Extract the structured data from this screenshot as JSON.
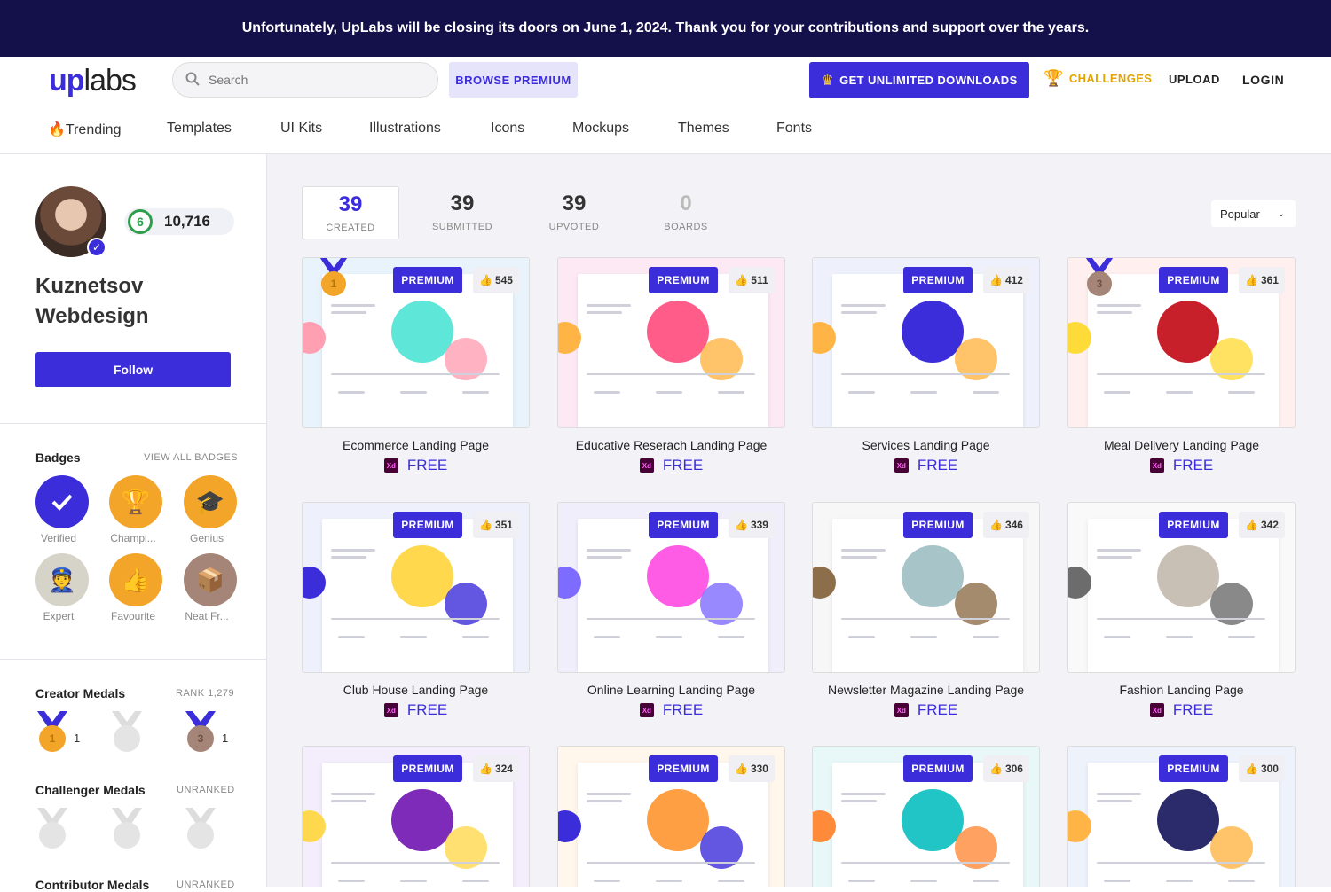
{
  "banner": "Unfortunately, UpLabs will be closing its doors on June 1, 2024. Thank you for your contributions and support over the years.",
  "header": {
    "logo_up": "up",
    "logo_labs": "labs",
    "search_placeholder": "Search",
    "browse_premium": "BROWSE PREMIUM",
    "unlimited": "GET UNLIMITED DOWNLOADS",
    "challenges": "CHALLENGES",
    "upload": "UPLOAD",
    "login": "LOGIN"
  },
  "nav": [
    "🔥Trending",
    "Templates",
    "UI Kits",
    "Illustrations",
    "Icons",
    "Mockups",
    "Themes",
    "Fonts"
  ],
  "profile": {
    "level": "6",
    "points": "10,716",
    "name_line1": "Kuznetsov",
    "name_line2": "Webdesign",
    "follow": "Follow"
  },
  "badges": {
    "title": "Badges",
    "view_all": "VIEW ALL BADGES",
    "items": [
      "Verified",
      "Champi...",
      "Genius",
      "Expert",
      "Favourite",
      "Neat Fr..."
    ]
  },
  "medals": {
    "creator_title": "Creator Medals",
    "creator_rank": "RANK 1,279",
    "creator_counts": [
      "1",
      "1"
    ],
    "creator_places": [
      "1",
      "3"
    ],
    "challenger_title": "Challenger Medals",
    "challenger_rank": "UNRANKED",
    "contributor_title": "Contributor Medals",
    "contributor_rank": "UNRANKED"
  },
  "stats": [
    {
      "value": "39",
      "label": "CREATED"
    },
    {
      "value": "39",
      "label": "SUBMITTED"
    },
    {
      "value": "39",
      "label": "UPVOTED"
    },
    {
      "value": "0",
      "label": "BOARDS"
    }
  ],
  "sort": "Popular",
  "card_labels": {
    "premium": "PREMIUM",
    "free": "FREE",
    "xd": "Xd"
  },
  "cards": [
    {
      "title": "Ecommerce Landing Page",
      "likes": "545",
      "medal": "1"
    },
    {
      "title": "Educative Reserach Landing Page",
      "likes": "511"
    },
    {
      "title": "Services Landing Page",
      "likes": "412"
    },
    {
      "title": "Meal Delivery Landing Page",
      "likes": "361",
      "medal": "3"
    },
    {
      "title": "Club House Landing Page",
      "likes": "351"
    },
    {
      "title": "Online Learning Landing Page",
      "likes": "339"
    },
    {
      "title": "Newsletter Magazine Landing Page",
      "likes": "346"
    },
    {
      "title": "Fashion Landing Page",
      "likes": "342"
    },
    {
      "title": "",
      "likes": "324"
    },
    {
      "title": "",
      "likes": "330"
    },
    {
      "title": "",
      "likes": "306"
    },
    {
      "title": "",
      "likes": "300"
    }
  ],
  "colors": {
    "accent": "#3c2ddb",
    "banner_bg": "#14104a",
    "challenge": "#e2a400"
  }
}
